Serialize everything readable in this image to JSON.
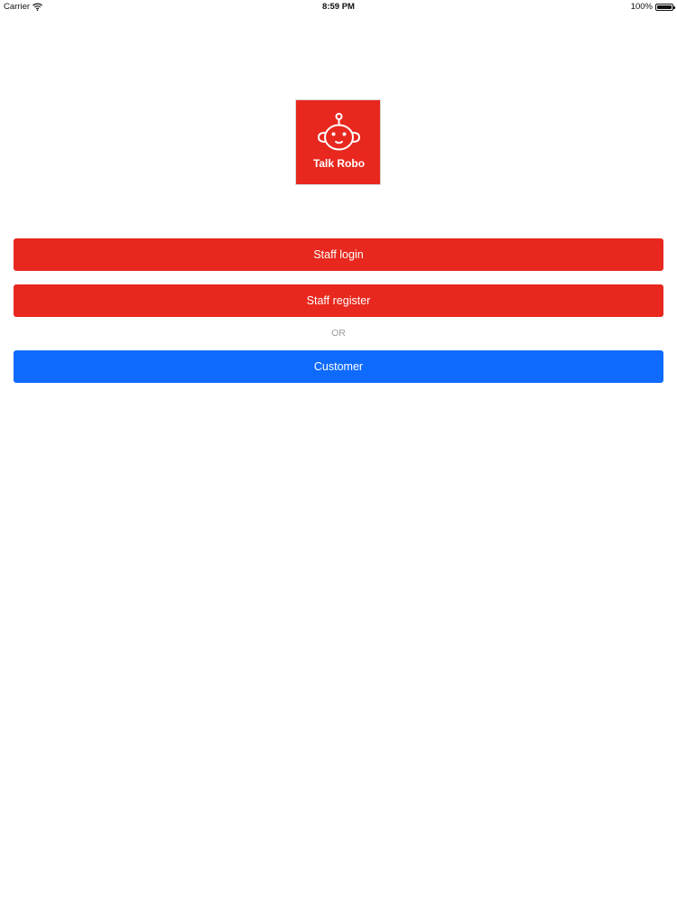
{
  "status_bar": {
    "carrier": "Carrier",
    "time": "8:59 PM",
    "battery": "100%",
    "battery_level": 1.0
  },
  "logo": {
    "text": "Talk Robo",
    "icon": "robot-icon",
    "background_color": "#e8281e"
  },
  "buttons": {
    "staff_login": "Staff login",
    "staff_register": "Staff register",
    "customer": "Customer"
  },
  "separator": "OR",
  "colors": {
    "primary_red": "#e8281e",
    "customer_blue": "#0f6bff",
    "separator_gray": "#9a9a9a"
  }
}
